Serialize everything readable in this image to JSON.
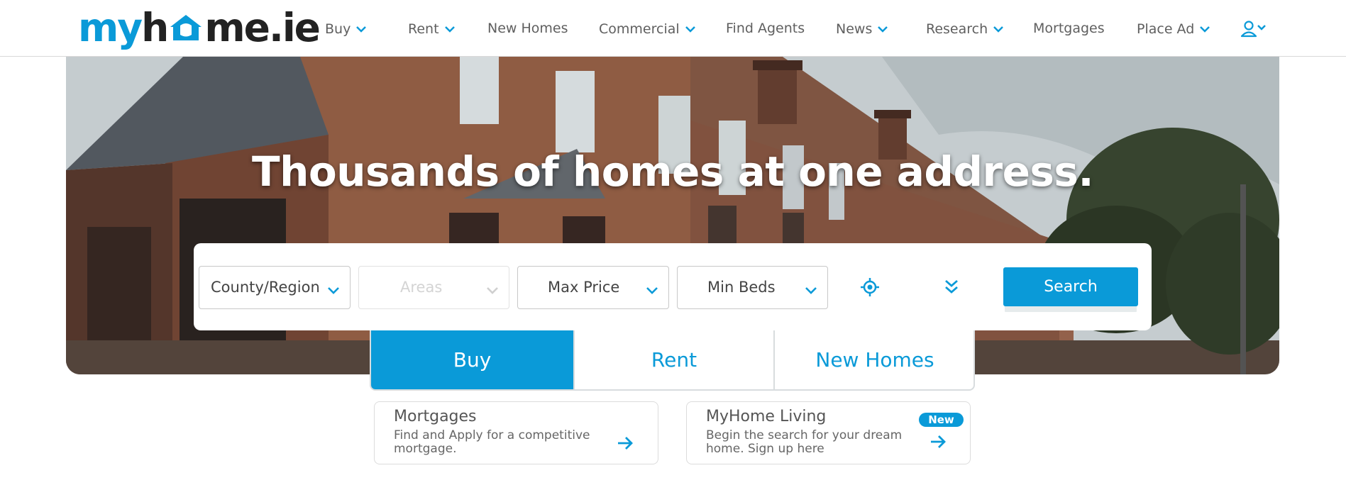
{
  "brand": {
    "logo_part1": "my",
    "logo_part2": "h",
    "logo_part3": "me.ie",
    "accent_color": "#0a9ad8"
  },
  "nav": {
    "items": [
      {
        "label": "Buy",
        "has_dropdown": true
      },
      {
        "label": "Rent",
        "has_dropdown": true
      },
      {
        "label": "New Homes",
        "has_dropdown": false
      },
      {
        "label": "Commercial",
        "has_dropdown": true
      },
      {
        "label": "Find Agents",
        "has_dropdown": false
      },
      {
        "label": "News",
        "has_dropdown": true
      },
      {
        "label": "Research",
        "has_dropdown": true
      },
      {
        "label": "Mortgages",
        "has_dropdown": false
      },
      {
        "label": "Place Ad",
        "has_dropdown": true
      }
    ],
    "user_icon": "user-icon"
  },
  "hero": {
    "title": "Thousands of homes at one address."
  },
  "search": {
    "county_value": "County/Region",
    "areas_value": "Areas",
    "max_price_value": "Max Price",
    "min_beds_value": "Min Beds",
    "location_icon": "locate-icon",
    "more_filters_icon": "double-chevron-down-icon",
    "button_label": "Search"
  },
  "tabs": [
    {
      "label": "Buy",
      "active": true
    },
    {
      "label": "Rent",
      "active": false
    },
    {
      "label": "New Homes",
      "active": false
    }
  ],
  "cards": {
    "mortgages": {
      "title": "Mortgages",
      "line1": "Find and Apply for a competitive",
      "line2": "mortgage."
    },
    "living": {
      "title": "MyHome Living",
      "badge": "New",
      "line1": "Begin the search for your dream",
      "line2": "home. Sign up here"
    }
  }
}
